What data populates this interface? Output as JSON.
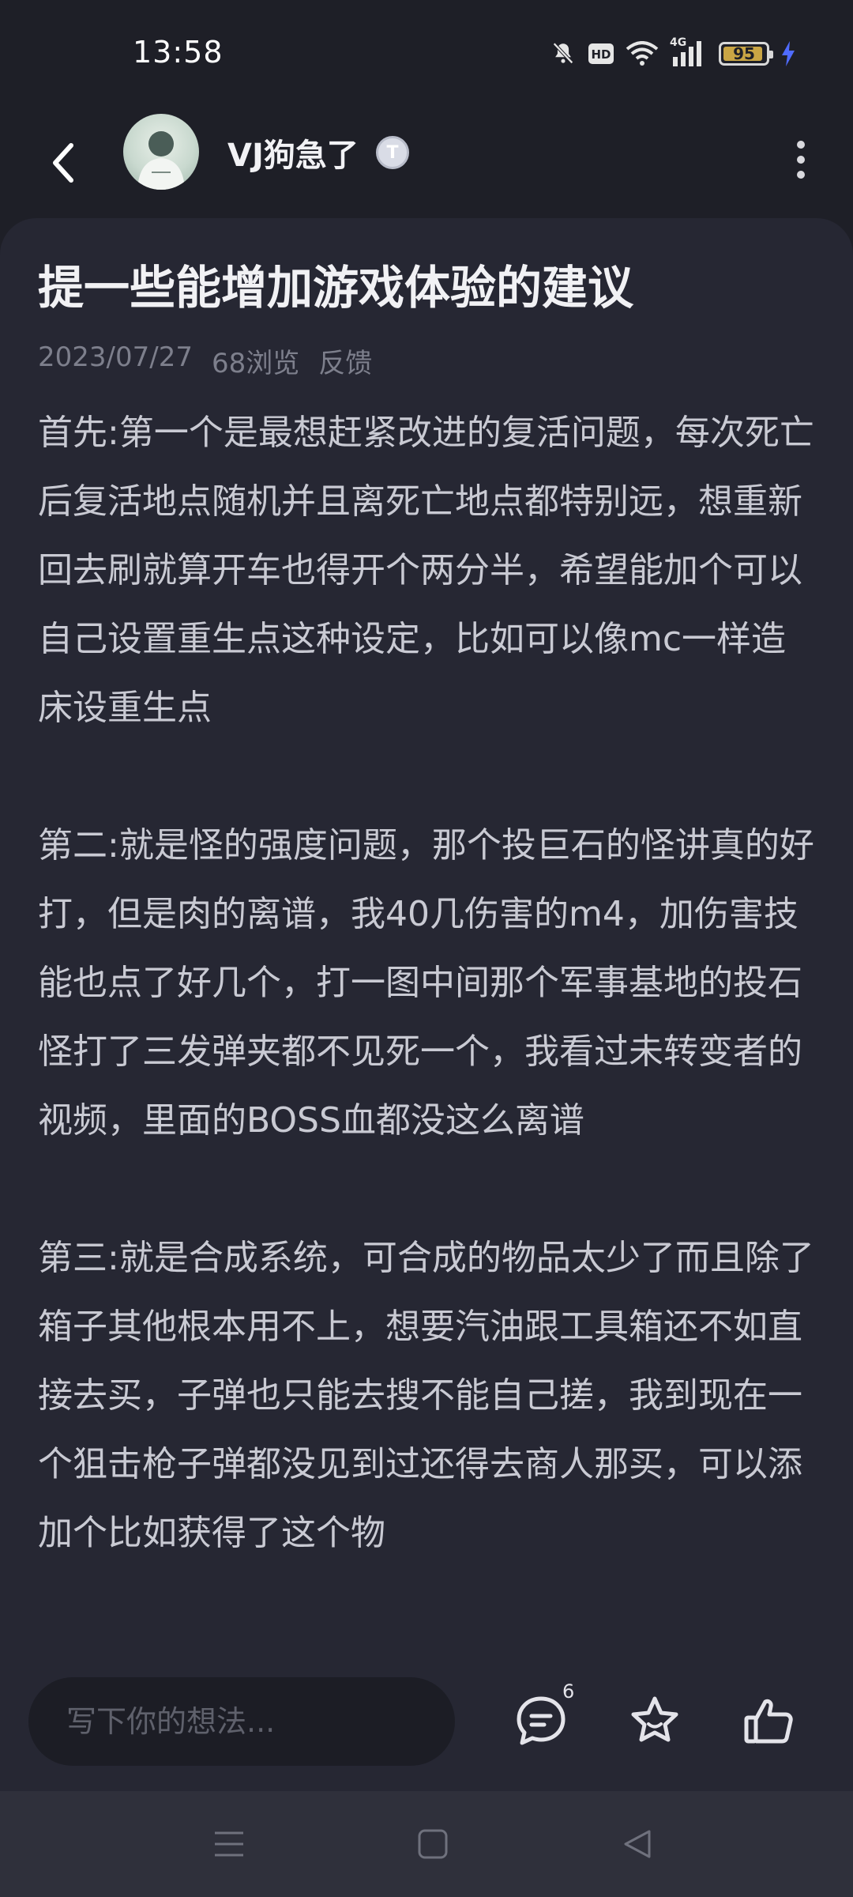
{
  "status_bar": {
    "time": "13:58",
    "network": "4G",
    "hd_label": "HD",
    "battery_level": "95",
    "battery_color": "#c9a544",
    "icons": [
      "mute-bell-icon",
      "hd-icon",
      "wifi-icon",
      "signal-icon",
      "battery-icon",
      "charging-icon"
    ]
  },
  "header": {
    "username": "VJ狗急了",
    "badge_letter": "T"
  },
  "post": {
    "title": "提一些能增加游戏体验的建议",
    "date": "2023/07/27",
    "views": "68浏览",
    "category": "反馈",
    "paragraphs": [
      "首先:第一个是最想赶紧改进的复活问题，每次死亡后复活地点随机并且离死亡地点都特别远，想重新回去刷就算开车也得开个两分半，希望能加个可以自己设置重生点这种设定，比如可以像mc一样造床设重生点",
      "第二:就是怪的强度问题，那个投巨石的怪讲真的好打，但是肉的离谱，我40几伤害的m4，加伤害技能也点了好几个，打一图中间那个军事基地的投石怪打了三发弹夹都不见死一个，我看过未转变者的视频，里面的BOSS血都没这么离谱",
      "第三:就是合成系统，可合成的物品太少了而且除了箱子其他根本用不上，想要汽油跟工具箱还不如直接去买，子弹也只能去搜不能自己搓，我到现在一个狙击枪子弹都没见到过还得去商人那买，可以添加个比如获得了这个物"
    ]
  },
  "action_bar": {
    "comment_placeholder": "写下你的想法...",
    "comment_count": "6"
  },
  "colors": {
    "background": "#1e1f27",
    "card": "#262733",
    "nav": "#2f303b"
  }
}
